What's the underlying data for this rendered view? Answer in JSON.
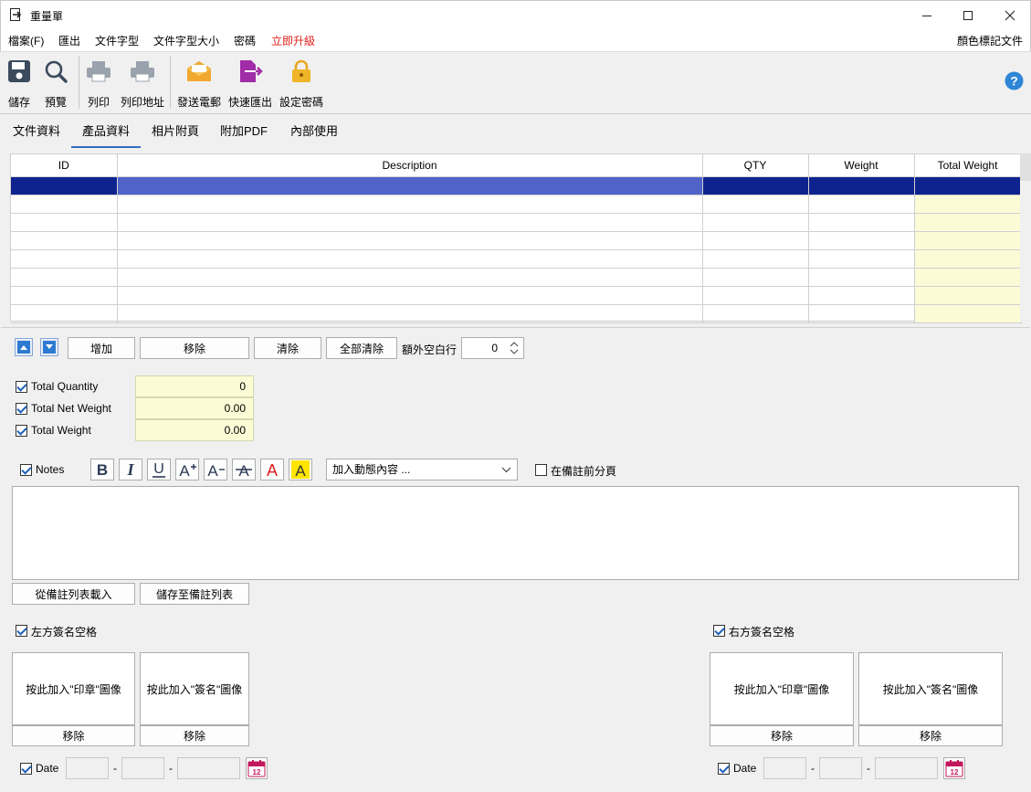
{
  "window": {
    "title": "重量單"
  },
  "menu": {
    "items": [
      "檔案(F)",
      "匯出",
      "文件字型",
      "文件字型大小",
      "密碼"
    ],
    "upgrade": "立即升級",
    "upgrade_color": "#e0201b",
    "right": "顏色標記文件"
  },
  "toolbar": {
    "save": "儲存",
    "preview": "預覽",
    "print": "列印",
    "print_address": "列印地址",
    "send_email": "發送電郵",
    "quick_export": "快速匯出",
    "set_password": "設定密碼"
  },
  "tabs": [
    "文件資料",
    "產品資料",
    "相片附頁",
    "附加PDF",
    "內部使用"
  ],
  "grid": {
    "columns": [
      "ID",
      "Description",
      "QTY",
      "Weight",
      "Total Weight"
    ]
  },
  "row_buttons": {
    "add": "增加",
    "remove": "移除",
    "clear": "清除",
    "clear_all": "全部清除",
    "extra_blank_label": "額外空白行",
    "extra_blank_value": "0"
  },
  "totals": {
    "qty_label": "Total Quantity",
    "qty_value": "0",
    "net_label": "Total Net Weight",
    "net_value": "0.00",
    "weight_label": "Total Weight",
    "weight_value": "0.00"
  },
  "notes": {
    "label": "Notes",
    "dynamic_placeholder": "加入動態內容 ...",
    "page_break_label": "在備註前分頁",
    "load_button": "從備註列表載入",
    "save_button": "儲存至備註列表"
  },
  "signature": {
    "left_label": "左方簽名空格",
    "right_label": "右方簽名空格",
    "add_stamp": "按此加入\"印章\"圖像",
    "add_sign": "按此加入\"簽名\"圖像",
    "remove": "移除",
    "date_label": "Date",
    "dash": "-",
    "calendar_day": "12"
  },
  "colors": {
    "selected_row": "#0f238f",
    "selected_desc": "#5064c8",
    "total_cell": "#fbfbd6",
    "accent": "#2e6fbd"
  }
}
